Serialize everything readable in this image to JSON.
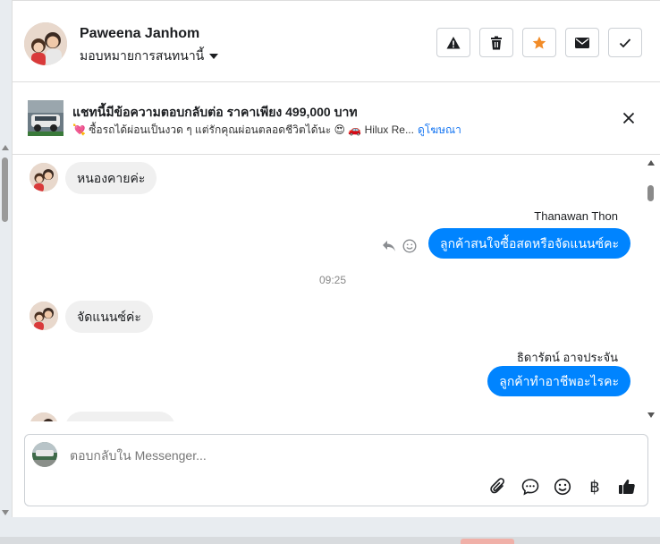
{
  "header": {
    "contact_name": "Paweena Janhom",
    "assign_label": "มอบหมายการสนทนานี้",
    "actions": [
      {
        "name": "report-spam-button",
        "icon": "warning-icon"
      },
      {
        "name": "delete-button",
        "icon": "trash-icon"
      },
      {
        "name": "star-button",
        "icon": "star-icon"
      },
      {
        "name": "mark-unread-button",
        "icon": "envelope-icon"
      },
      {
        "name": "mark-done-button",
        "icon": "check-icon"
      }
    ],
    "star_color": "#f28c28"
  },
  "ad": {
    "title": "แชทนี้มีข้อความตอบกลับต่อ ราคาเพียง 499,000 บาท",
    "subtitle": "💘 ซื้อรถได้ผ่อนเป็นงวด ๆ แต่รักคุณผ่อนตลอดชีวิตได้นะ 😍 🚗 Hilux Re...",
    "link": "ดูโฆษณา"
  },
  "messages": [
    {
      "type": "incoming",
      "text": "หนองคายค่ะ"
    },
    {
      "type": "outgoing",
      "sender": "Thanawan Thon",
      "text": "ลูกค้าสนใจซื้อสดหรือจัดแนนซ์คะ"
    },
    {
      "type": "timestamp",
      "text": "09:25"
    },
    {
      "type": "incoming",
      "text": "จัดแนนซ์ค่ะ"
    },
    {
      "type": "outgoing",
      "sender": "ธิดารัตน์ อาจประจัน",
      "text": "ลูกค้าทำอาชีพอะไรคะ"
    }
  ],
  "composer": {
    "placeholder": "ตอบกลับใน Messenger...",
    "tools": [
      "attach-icon",
      "saved-reply-icon",
      "emoji-icon",
      "payment-icon",
      "thumbs-up-icon"
    ],
    "baht_symbol": "฿"
  },
  "colors": {
    "outgoing_bubble": "#0084ff",
    "incoming_bubble": "#f0f0f0",
    "link": "#1877f2"
  }
}
